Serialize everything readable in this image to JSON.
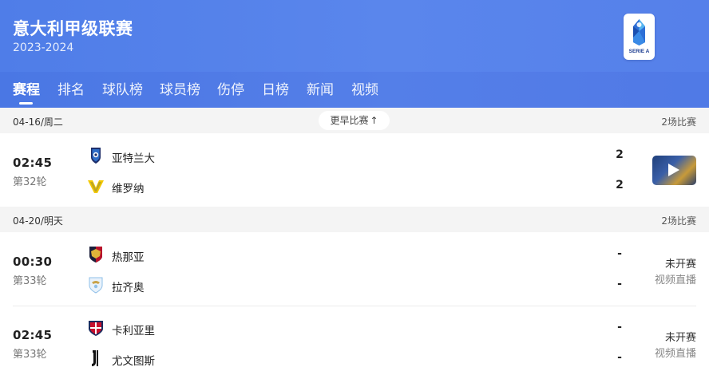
{
  "league": {
    "title": "意大利甲级联赛",
    "season": "2023-2024",
    "logo_text": "SERIE A"
  },
  "tabs": [
    {
      "label": "赛程",
      "active": true
    },
    {
      "label": "排名"
    },
    {
      "label": "球队榜"
    },
    {
      "label": "球员榜"
    },
    {
      "label": "伤停"
    },
    {
      "label": "日榜"
    },
    {
      "label": "新闻"
    },
    {
      "label": "视频"
    }
  ],
  "earlier_button": "更早比赛",
  "days": [
    {
      "date": "04-16/周二",
      "count": "2场比赛",
      "matches": [
        {
          "time": "02:45",
          "round": "第32轮",
          "home": {
            "name": "亚特兰大",
            "crest": "atalanta-crest",
            "score": "2"
          },
          "away": {
            "name": "维罗纳",
            "crest": "verona-crest",
            "score": "2"
          },
          "video_thumbnail": "match-highlight-thumbnail"
        }
      ]
    },
    {
      "date": "04-20/明天",
      "count": "2场比赛",
      "matches": [
        {
          "time": "00:30",
          "round": "第33轮",
          "home": {
            "name": "热那亚",
            "crest": "genoa-crest",
            "score": "-"
          },
          "away": {
            "name": "拉齐奥",
            "crest": "lazio-crest",
            "score": "-"
          },
          "status": "未开赛",
          "substatus": "视频直播"
        },
        {
          "time": "02:45",
          "round": "第33轮",
          "home": {
            "name": "卡利亚里",
            "crest": "cagliari-crest",
            "score": "-"
          },
          "away": {
            "name": "尤文图斯",
            "crest": "juventus-crest",
            "score": "-"
          },
          "status": "未开赛",
          "substatus": "视频直播"
        }
      ]
    }
  ],
  "colors": {
    "header": "#5580ea",
    "date_bar": "#f4f4f4"
  }
}
